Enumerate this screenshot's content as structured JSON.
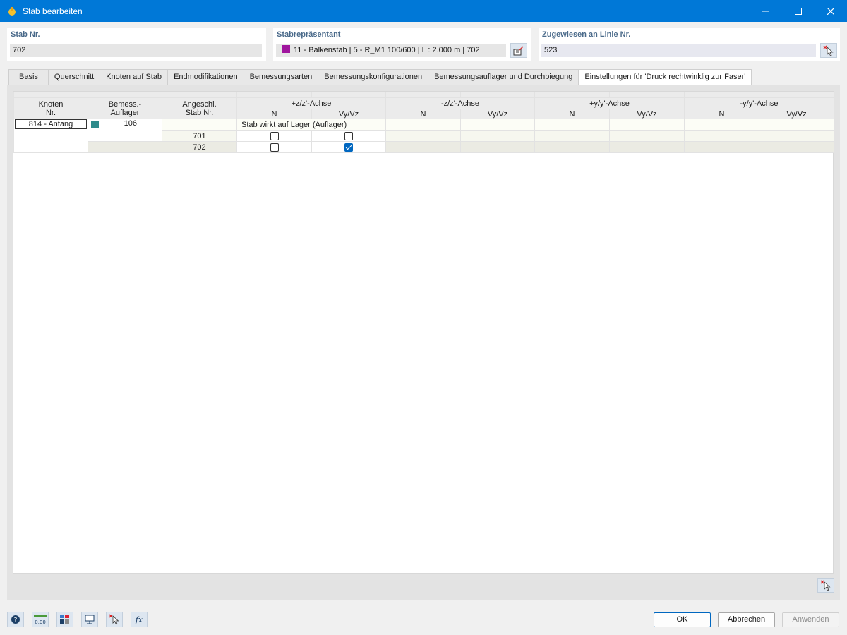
{
  "window": {
    "title": "Stab bearbeiten"
  },
  "header": {
    "stab_nr": {
      "label": "Stab Nr.",
      "value": "702"
    },
    "repr": {
      "label": "Stabrepräsentant",
      "value": "11 - Balkenstab | 5 - R_M1 100/600 | L : 2.000 m | 702",
      "swatch_color": "#a0169e"
    },
    "linie": {
      "label": "Zugewiesen an Linie Nr.",
      "value": "523"
    }
  },
  "tabs": [
    {
      "label": "Basis"
    },
    {
      "label": "Querschnitt"
    },
    {
      "label": "Knoten auf Stab"
    },
    {
      "label": "Endmodifikationen"
    },
    {
      "label": "Bemessungsarten"
    },
    {
      "label": "Bemessungskonfigurationen"
    },
    {
      "label": "Bemessungsauflager und Durchbiegung"
    },
    {
      "label": "Einstellungen für 'Druck rechtwinklig zur Faser'"
    }
  ],
  "grid": {
    "headers": {
      "knoten_l1": "Knoten",
      "knoten_l2": "Nr.",
      "bemess_l1": "Bemess.-",
      "bemess_l2": "Auflager",
      "angeschl_l1": "Angeschl.",
      "angeschl_l2": "Stab Nr.",
      "pz": "+z/z'-Achse",
      "mz": "-z/z'-Achse",
      "py": "+y/y'-Achse",
      "my": "-y/y'-Achse",
      "n": "N",
      "v": "Vy/Vz"
    },
    "row": {
      "knoten": "814 - Anfang",
      "auflager": "106",
      "auflager_color": "#2e8b8b",
      "note": "Stab wirkt auf Lager (Auflager)",
      "sub": [
        {
          "stab": "701",
          "n": false,
          "v": false
        },
        {
          "stab": "702",
          "n": false,
          "v": true
        }
      ]
    }
  },
  "buttons": {
    "ok": "OK",
    "cancel": "Abbrechen",
    "apply": "Anwenden"
  },
  "footer_icons": [
    "help-icon",
    "units-icon",
    "display-icon",
    "view-icon",
    "select-icon",
    "formula-icon"
  ]
}
